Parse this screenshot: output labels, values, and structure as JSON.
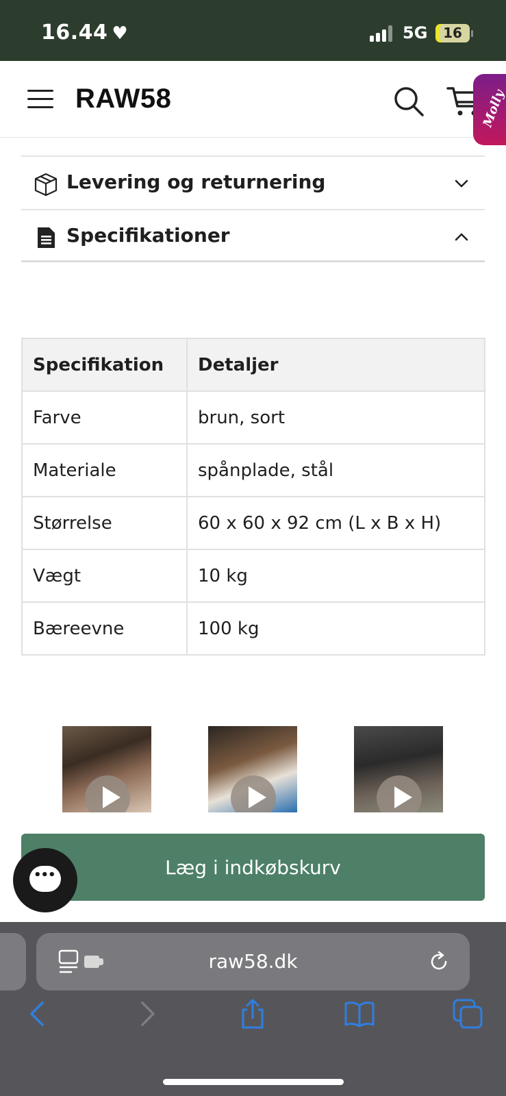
{
  "status": {
    "time": "16.44",
    "heart": "♥",
    "network": "5G",
    "battery": "16"
  },
  "header": {
    "logo": "RAW58",
    "molly_badge": "Molly"
  },
  "accordion": [
    {
      "label": "Levering og returnering",
      "icon": "package-icon",
      "state": "collapsed"
    },
    {
      "label": "Specifikationer",
      "icon": "document-icon",
      "state": "expanded"
    }
  ],
  "spec_table": {
    "headers": [
      "Specifikation",
      "Detaljer"
    ],
    "rows": [
      [
        "Farve",
        "brun, sort"
      ],
      [
        "Materiale",
        "spånplade, stål"
      ],
      [
        "Størrelse",
        "60 x 60 x 92 cm (L x B x H)"
      ],
      [
        "Vægt",
        "10 kg"
      ],
      [
        "Bæreevne",
        "100 kg"
      ]
    ]
  },
  "cart_button": {
    "label": "Læg i indkøbskurv",
    "color": "#4d8067"
  },
  "browser": {
    "url": "raw58.dk"
  },
  "colors": {
    "status_bar": "#2c3d2d",
    "accent_green": "#4d8067",
    "molly_gradient": [
      "#7c1d8a",
      "#c2185b"
    ],
    "browser_bar": "#56565a",
    "nav_blue": "#2f7fe0"
  }
}
